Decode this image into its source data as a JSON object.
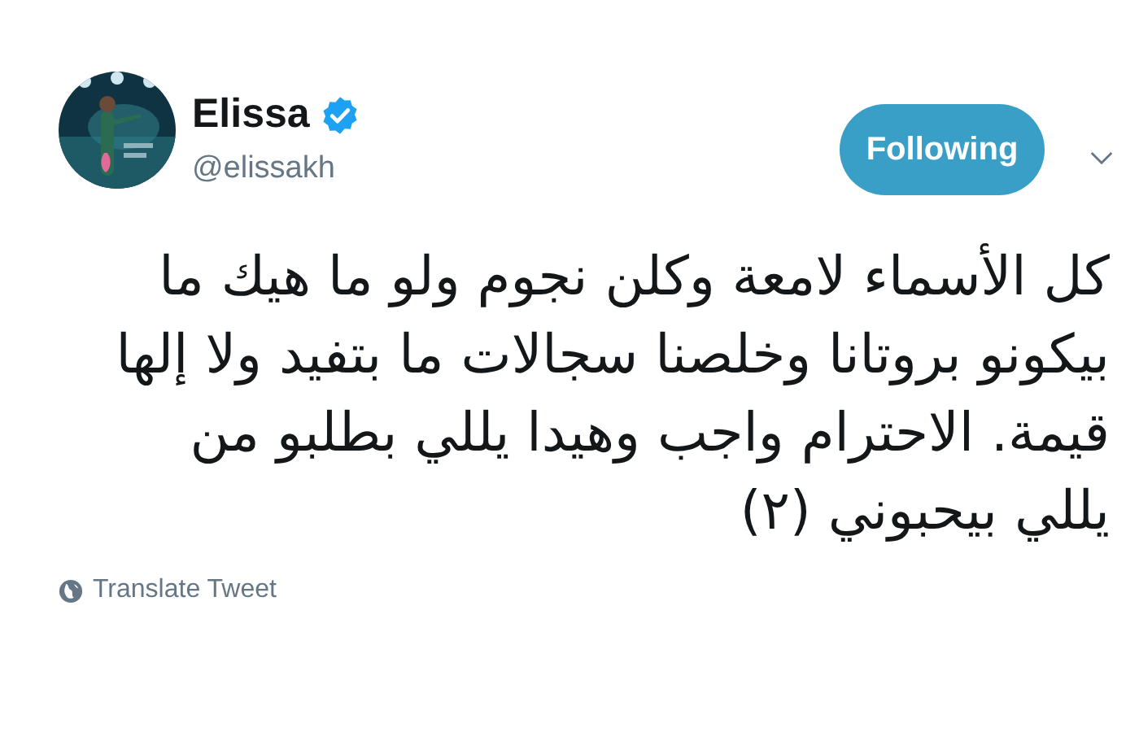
{
  "author": {
    "name": "Elissa",
    "verified": true,
    "handle": "@elissakh"
  },
  "follow_button": {
    "label": "Following"
  },
  "tweet": {
    "text": "كل الأسماء لامعة وكلن نجوم ولو ما هيك ما بيكونو بروتانا وخلصنا سجالات ما بتفيد ولا إلها قيمة. الاحترام واجب وهيدا يللي بطلبو من يللي بيحبوني (٢)"
  },
  "translate_link": {
    "label": "Translate Tweet"
  }
}
